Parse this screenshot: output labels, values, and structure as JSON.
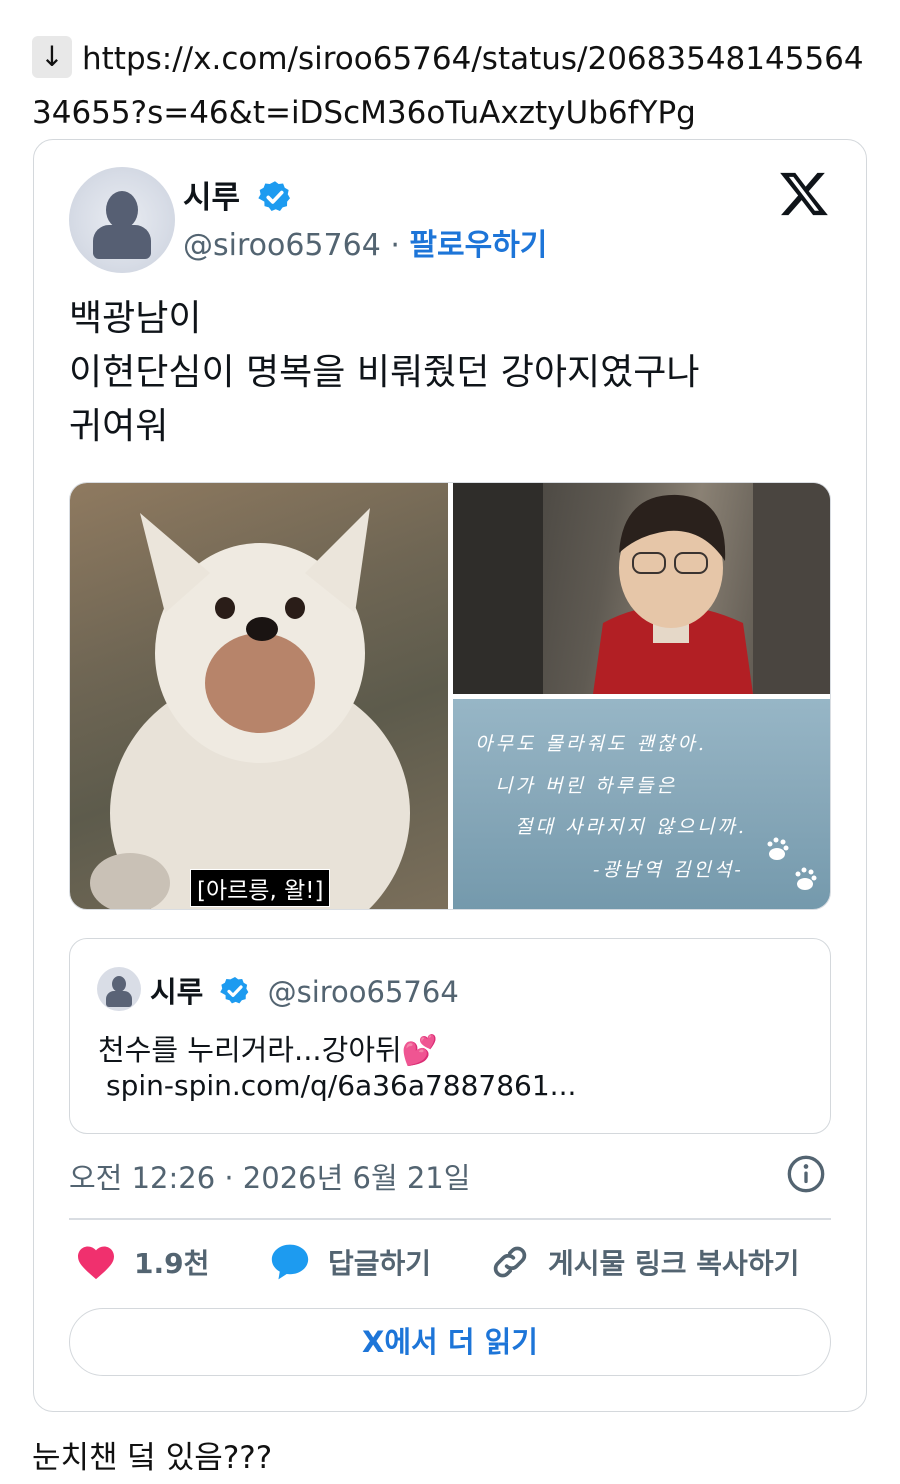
{
  "link": {
    "arrow": "↓",
    "url": "https://x.com/siroo65764/status/2068354814556434655?s=46&t=iDScM36oTuAxztyUb6fYPg"
  },
  "tweet": {
    "author_name": "시루",
    "verified_icon": "verified-badge-icon",
    "handle": "@siroo65764",
    "separator": " · ",
    "follow_label": "팔로우하기",
    "text_lines": [
      "백광남이",
      "이현단심이 명복을 비뤄줬던 강아지였구나",
      "귀여워"
    ],
    "media": {
      "dog_subtitle": "[아르릉, 왈!]",
      "sea_text_lines": [
        "아무도 몰라줘도 괜찮아.",
        "니가 버린 하루들은",
        "절대 사라지지 않으니까.",
        "-광남역 김인석-"
      ]
    },
    "quote": {
      "author_name": "시루",
      "handle": "@siroo65764",
      "text": "천수를 누리거라...강아뒤💕",
      "link": "spin-spin.com/q/6a36a7887861..."
    },
    "timestamp": "오전 12:26 · 2026년 6월 21일",
    "actions": {
      "like_count": "1.9천",
      "reply_label": "답글하기",
      "copy_label": "게시물 링크 복사하기"
    },
    "read_more_label": "X에서 더 읽기"
  },
  "footer_text": "눈치챈 덬 있음???",
  "colors": {
    "accent": "#1d75d8",
    "like": "#f0306e",
    "reply": "#1d9bf0",
    "verified": "#1d9bf0"
  }
}
